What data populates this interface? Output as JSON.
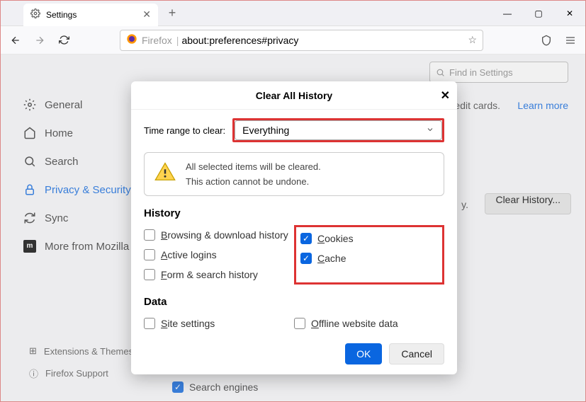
{
  "tab": {
    "title": "Settings"
  },
  "url": {
    "protocol": "Firefox",
    "path": "about:preferences#privacy"
  },
  "search_settings_placeholder": "Find in Settings",
  "sidebar": {
    "items": [
      {
        "label": "General"
      },
      {
        "label": "Home"
      },
      {
        "label": "Search"
      },
      {
        "label": "Privacy & Security"
      },
      {
        "label": "Sync"
      },
      {
        "label": "More from Mozilla"
      }
    ]
  },
  "lower_links": {
    "extensions": "Extensions & Themes",
    "support": "Firefox Support"
  },
  "background": {
    "credit_cards": "credit cards.",
    "learn_more": "Learn more",
    "y_end": "y.",
    "clear_history": "Clear History...",
    "search_engines": "Search engines"
  },
  "dialog": {
    "title": "Clear All History",
    "time_label": "Time range to clear:",
    "time_value": "Everything",
    "warning_line1": "All selected items will be cleared.",
    "warning_line2": "This action cannot be undone.",
    "history_header": "History",
    "data_header": "Data",
    "checks": {
      "browsing": {
        "label": "Browsing & download history",
        "checked": false
      },
      "logins": {
        "label": "Active logins",
        "checked": false
      },
      "form": {
        "label": "Form & search history",
        "checked": false
      },
      "cookies": {
        "label": "Cookies",
        "checked": true
      },
      "cache": {
        "label": "Cache",
        "checked": true
      },
      "site": {
        "label": "Site settings",
        "checked": false
      },
      "offline": {
        "label": "Offline website data",
        "checked": false
      }
    },
    "ok": "OK",
    "cancel": "Cancel"
  }
}
